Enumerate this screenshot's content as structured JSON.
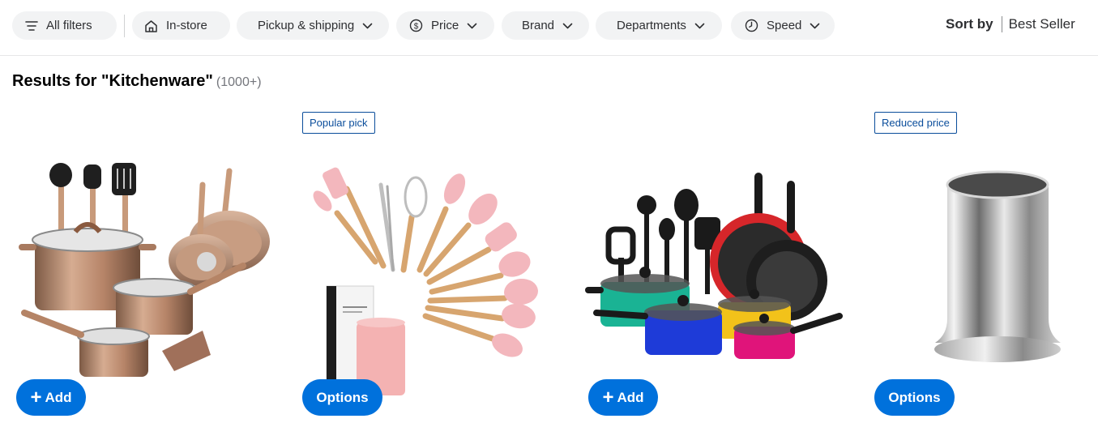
{
  "filters": {
    "all_filters": "All filters",
    "in_store": "In-store",
    "pickup_shipping": "Pickup & shipping",
    "price": "Price",
    "brand": "Brand",
    "departments": "Departments",
    "speed": "Speed"
  },
  "sort": {
    "label": "Sort by",
    "value": "Best Seller"
  },
  "results": {
    "title": "Results for \"Kitchenware\"",
    "count": "(1000+)"
  },
  "products": [
    {
      "badge": "",
      "action_label": "Add",
      "image": "copper-cookware-set"
    },
    {
      "badge": "Popular pick",
      "action_label": "Options",
      "image": "pink-silicone-utensil-set"
    },
    {
      "badge": "",
      "action_label": "Add",
      "image": "colorful-cookware-set"
    },
    {
      "badge": "Reduced price",
      "action_label": "Options",
      "image": "stainless-utensil-holder"
    }
  ],
  "colors": {
    "accent": "#0071dc",
    "badge_border": "#0a4d9b",
    "chip_bg": "#f2f3f4"
  }
}
